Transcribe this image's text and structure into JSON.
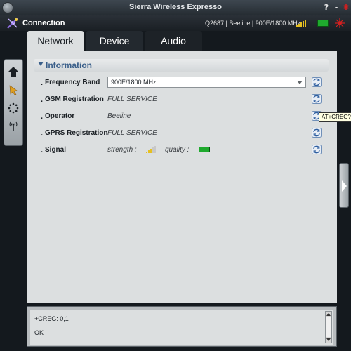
{
  "window": {
    "title": "Sierra Wireless Expresso",
    "help_label": "?",
    "minimize_label": "-",
    "close_label": "✱"
  },
  "connection": {
    "label": "Connection",
    "info": "Q2687 | Beeline | 900E/1800 MHz",
    "battery_color": "#1faa2e"
  },
  "tabs": [
    {
      "label": "Network",
      "active": true
    },
    {
      "label": "Device",
      "active": false
    },
    {
      "label": "Audio",
      "active": false
    }
  ],
  "leftnav": {
    "items": [
      {
        "icon": "home-icon"
      },
      {
        "icon": "pointer-icon"
      },
      {
        "icon": "loading-icon"
      },
      {
        "icon": "antenna-icon"
      }
    ]
  },
  "section": {
    "title": "Information"
  },
  "rows": {
    "frequency_band": {
      "label": "Frequency Band",
      "value": "900E/1800 MHz"
    },
    "gsm_registration": {
      "label": "GSM Registration",
      "value": "FULL SERVICE"
    },
    "operator": {
      "label": "Operator",
      "value": "Beeline"
    },
    "gprs_registration": {
      "label": "GPRS Registration",
      "value": "FULL SERVICE"
    },
    "signal": {
      "label": "Signal",
      "strength_label": "strength :",
      "quality_label": "quality :",
      "quality_color": "#1faa2e"
    }
  },
  "tooltip": "AT+CREG?",
  "console": {
    "lines": [
      "+CREG: 0,1",
      "OK"
    ]
  },
  "colors": {
    "accent": "#3a5f8a",
    "background": "#14191e",
    "panel": "#dcdfe0"
  }
}
